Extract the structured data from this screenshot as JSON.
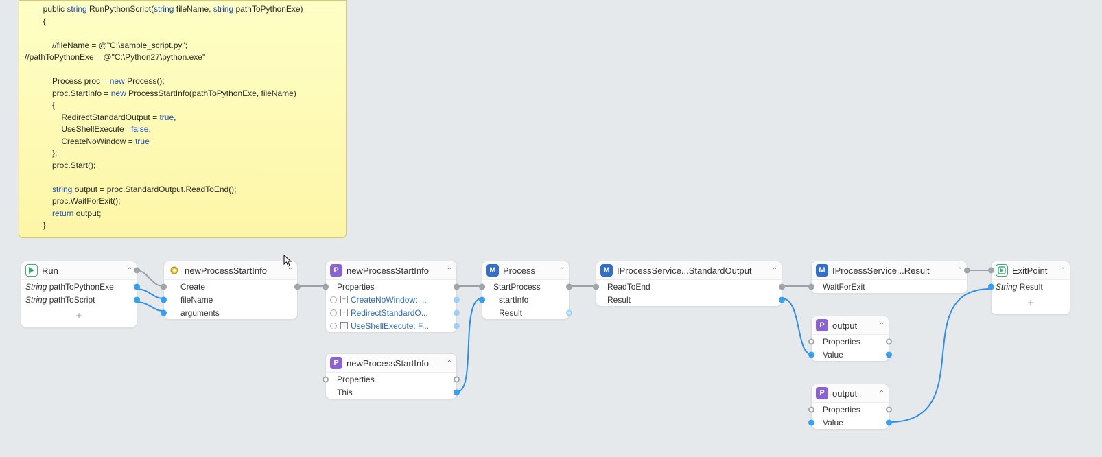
{
  "code_note": {
    "line1a": "        public ",
    "kw1": "string",
    "line1b": " RunPythonScript(",
    "kw2": "string",
    "line1c": " fileName, ",
    "kw3": "string",
    "line1d": " pathToPythonExe)",
    "line2": "        {",
    "line3": "",
    "line4": "            //fileName = @\"C:\\sample_script.py\";",
    "line5": "//pathToPythonExe = @\"C:\\Python27\\python.exe\"",
    "line6": "",
    "line7a": "            Process proc = ",
    "kw4": "new",
    "line7b": " Process();",
    "line8a": "            proc.StartInfo = ",
    "kw5": "new",
    "line8b": " ProcessStartInfo(pathToPythonExe, fileName)",
    "line9": "            {",
    "line10a": "                RedirectStandardOutput = ",
    "kw6": "true",
    "line10b": ",",
    "line11a": "                UseShellExecute =",
    "kw7": "false",
    "line11b": ",",
    "line12a": "                CreateNoWindow = ",
    "kw8": "true",
    "line13": "            };",
    "line14": "            proc.Start();",
    "line15": "",
    "line16a": "            ",
    "kw9": "string",
    "line16b": " output = proc.StandardOutput.ReadToEnd();",
    "line17": "            proc.WaitForExit();",
    "line18a": "            ",
    "kw10": "return",
    "line18b": " output;",
    "line19": "        }"
  },
  "nodes": {
    "run": {
      "title": "Run",
      "param1_type": "String",
      "param1_name": " pathToPythonExe",
      "param2_type": "String",
      "param2_name": " pathToScript",
      "plus": "+"
    },
    "psi_gear": {
      "title": "newProcessStartInfo",
      "r1": "Create",
      "r2": "fileName",
      "r3": "arguments"
    },
    "psi_p1": {
      "title": "newProcessStartInfo",
      "r1": "Properties",
      "r2": "CreateNoWindow: ...",
      "r3": "RedirectStandardO...",
      "r4": "UseShellExecute: F..."
    },
    "psi_p2": {
      "title": "newProcessStartInfo",
      "r1": "Properties",
      "r2": "This"
    },
    "process": {
      "title": "Process",
      "r1": "StartProcess",
      "r2": "startInfo",
      "r3": "Result"
    },
    "ps_std": {
      "title": "IProcessService...StandardOutput",
      "r1": "ReadToEnd",
      "r2": "Result"
    },
    "ps_wait": {
      "title": "IProcessService...Result",
      "r1": "WaitForExit"
    },
    "output1": {
      "title": "output",
      "r1": "Properties",
      "r2": "Value"
    },
    "output2": {
      "title": "output",
      "r1": "Properties",
      "r2": "Value"
    },
    "exit": {
      "title": "ExitPoint",
      "r1_type": "String",
      "r1_name": " Result",
      "plus": "+"
    }
  }
}
